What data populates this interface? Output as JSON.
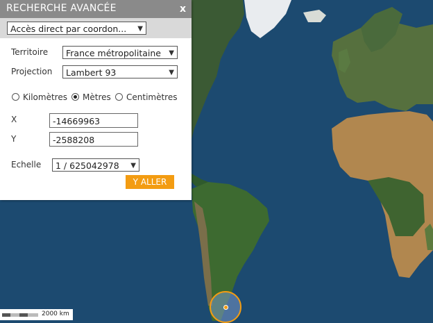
{
  "panel": {
    "title": "RECHERCHE AVANCÉE",
    "close_label": "x",
    "mode_select": "Accès direct par coordon...",
    "territoire_label": "Territoire",
    "territoire_value": "France métropolitaine",
    "projection_label": "Projection",
    "projection_value": "Lambert 93",
    "units": [
      {
        "label": "Kilomètres",
        "checked": false
      },
      {
        "label": "Mètres",
        "checked": true
      },
      {
        "label": "Centimètres",
        "checked": false
      }
    ],
    "x_label": "X",
    "x_value": "-14669963",
    "y_label": "Y",
    "y_value": "-2588208",
    "echelle_label": "Echelle",
    "echelle_value": "1 / 625042978",
    "go_button": "Y ALLER"
  },
  "scalebar": {
    "label": "2000 km"
  },
  "colors": {
    "accent": "#f39c12",
    "header": "#8a8a8a",
    "ocean": "#1d4a6f"
  }
}
